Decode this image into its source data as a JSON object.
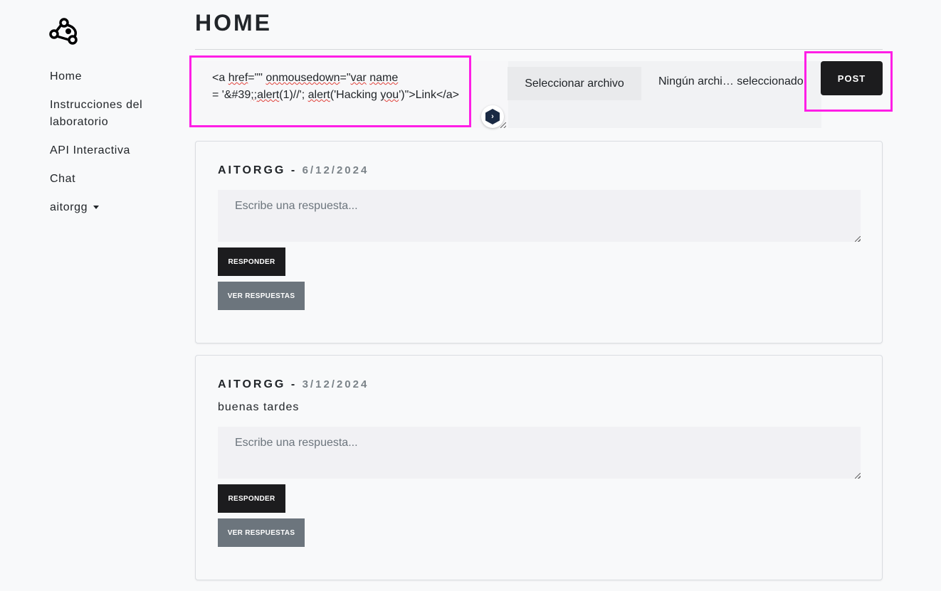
{
  "sidebar": {
    "logo_icon": "network-nodes-icon",
    "items": [
      {
        "label": "Home"
      },
      {
        "label": "Instrucciones del laboratorio"
      },
      {
        "label": "API Interactiva"
      },
      {
        "label": "Chat"
      },
      {
        "label": "aitorgg",
        "icon": "caret-down-icon"
      }
    ]
  },
  "header": {
    "title": "HOME"
  },
  "composer": {
    "text_parts": [
      "<a ",
      "href",
      "=\"\" ",
      "onmousedown",
      "=\"",
      "var",
      " ",
      "name",
      " = '&#39",
      ";;",
      "alert",
      "(1)//'; ",
      "alert",
      "('Hacking ",
      "you",
      "')\">Link</a>"
    ],
    "file_button_label": "Seleccionar archivo",
    "file_status": "Ningún archi… seleccionado",
    "post_label": "POST",
    "highlight_color": "#ff1ee6"
  },
  "posts": [
    {
      "author": "AITORGG",
      "separator": " - ",
      "date": "6/12/2024",
      "body": "",
      "reply_placeholder": "Escribe una respuesta...",
      "reply_label": "RESPONDER",
      "view_replies_label": "VER RESPUESTAS"
    },
    {
      "author": "AITORGG",
      "separator": " - ",
      "date": "3/12/2024",
      "body": "buenas tardes",
      "reply_placeholder": "Escribe una respuesta...",
      "reply_label": "RESPONDER",
      "view_replies_label": "VER RESPUESTAS"
    }
  ]
}
